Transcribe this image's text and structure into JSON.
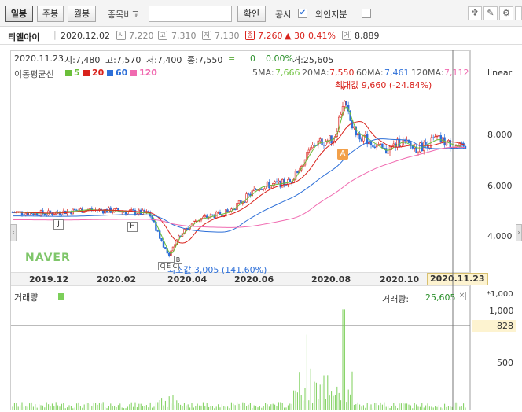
{
  "toolbar": {
    "period_buttons": [
      "일봉",
      "주봉",
      "월봉"
    ],
    "compare_label": "종목비교",
    "confirm_label": "확인",
    "disclosure_label": "공시",
    "foreign_label": "외인지분"
  },
  "price_bar": {
    "name": "티엘아이",
    "date": "2020.12.02",
    "open_label": "시",
    "open": "7,220",
    "high_label": "고",
    "high": "7,310",
    "low_label": "저",
    "low": "7,130",
    "close_label": "종",
    "close": "7,260",
    "change": "▲ 30",
    "change_pct": "0.41%",
    "volume_label": "거",
    "volume": "8,889"
  },
  "info_line": {
    "date": "2020.11.23",
    "open": "시:7,480",
    "high": "고:7,570",
    "low": "저:7,400",
    "close": "종:7,550",
    "flat_mark": "=",
    "change": "0",
    "change_pct": "0.00%",
    "volume": "거:25,605"
  },
  "legend": {
    "title": "이동평균선",
    "items": [
      {
        "label": "5",
        "color": "#6bbf3a"
      },
      {
        "label": "20",
        "color": "#d9221c"
      },
      {
        "label": "60",
        "color": "#2d6fd8"
      },
      {
        "label": "120",
        "color": "#f06ab0"
      }
    ]
  },
  "ma_values": {
    "ma5_label": "5MA:",
    "ma5": "7,666",
    "ma20_label": "20MA:",
    "ma20": "7,550",
    "ma60_label": "60MA:",
    "ma60": "7,461",
    "ma120_label": "120MA:",
    "ma120": "7,112",
    "scale": "linear"
  },
  "annotations": {
    "max": "최대값 9,660 (-24.84%)",
    "min": "최소값 3,005 (141.60%)",
    "badge_a": "A",
    "markers": [
      "J",
      "H",
      "C",
      "E",
      "C",
      "B"
    ]
  },
  "x_ticks": [
    "2019.12",
    "2020.02",
    "2020.04",
    "2020.06",
    "2020.08",
    "2020.10"
  ],
  "x_current": "2020.11.23",
  "price_ticks": [
    "8,000",
    "6,000",
    "4,000"
  ],
  "volume_panel": {
    "title": "거래량",
    "legend_label": "거래량:",
    "legend_value": "25,605",
    "multiplier": "*1,000",
    "ticks": [
      "1,000",
      "500"
    ],
    "current": "828"
  },
  "watermark": "NAVER",
  "colors": {
    "up": "#d9221c",
    "down": "#2d6fd8",
    "ma5": "#6bbf3a",
    "ma20": "#d9221c",
    "ma60": "#2d6fd8",
    "ma120": "#f06ab0",
    "volume": "#7ccf5a"
  }
}
